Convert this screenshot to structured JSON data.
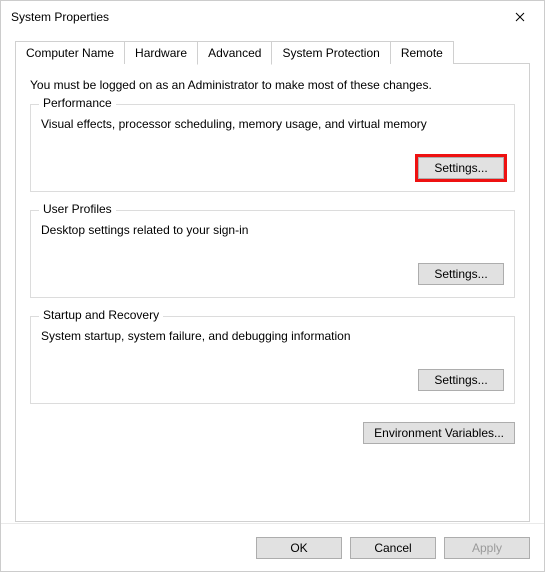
{
  "window": {
    "title": "System Properties"
  },
  "tabs": {
    "computer_name": "Computer Name",
    "hardware": "Hardware",
    "advanced": "Advanced",
    "system_protection": "System Protection",
    "remote": "Remote"
  },
  "panel": {
    "intro": "You must be logged on as an Administrator to make most of these changes.",
    "performance": {
      "title": "Performance",
      "desc": "Visual effects, processor scheduling, memory usage, and virtual memory",
      "button": "Settings..."
    },
    "user_profiles": {
      "title": "User Profiles",
      "desc": "Desktop settings related to your sign-in",
      "button": "Settings..."
    },
    "startup_recovery": {
      "title": "Startup and Recovery",
      "desc": "System startup, system failure, and debugging information",
      "button": "Settings..."
    },
    "env_button": "Environment Variables..."
  },
  "footer": {
    "ok": "OK",
    "cancel": "Cancel",
    "apply": "Apply"
  }
}
